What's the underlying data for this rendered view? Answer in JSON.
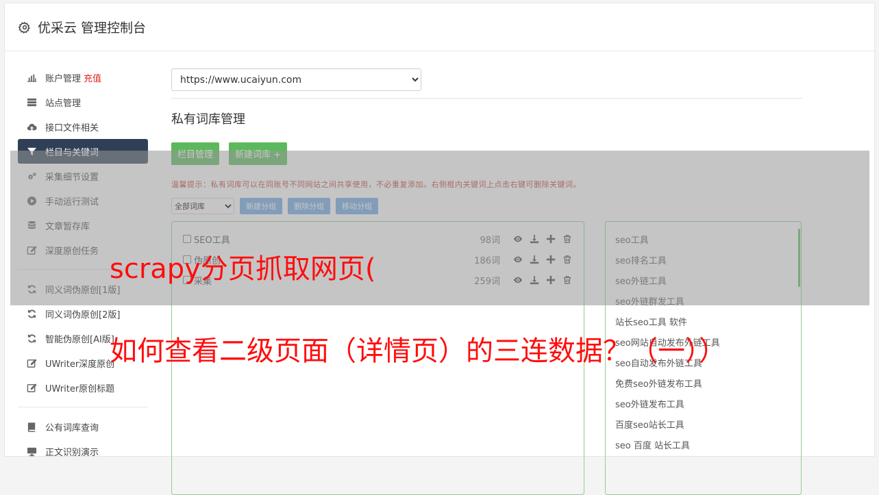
{
  "header": {
    "title": "优采云 管理控制台",
    "icon": "gear-icon"
  },
  "sidebar": {
    "items": [
      {
        "label": "账户管理",
        "extra": "充值",
        "icon": "bar-chart-icon"
      },
      {
        "label": "站点管理",
        "icon": "server-icon"
      },
      {
        "label": "接口文件相关",
        "icon": "cloud-upload-icon"
      },
      {
        "label": "栏目与关键词",
        "icon": "filter-icon",
        "active": true
      },
      {
        "label": "采集细节设置",
        "icon": "cogs-icon"
      },
      {
        "label": "手动运行测试",
        "icon": "play-circle-icon"
      },
      {
        "label": "文章暂存库",
        "icon": "database-icon"
      },
      {
        "label": "深度原创任务",
        "icon": "edit-icon"
      }
    ],
    "items2": [
      {
        "label": "同义词伪原创[1版]",
        "icon": "refresh-icon"
      },
      {
        "label": "同义词伪原创[2版]",
        "icon": "refresh-icon"
      },
      {
        "label": "智能伪原创[AI版]",
        "icon": "refresh-icon"
      },
      {
        "label": "UWriter深度原创",
        "icon": "edit-icon"
      },
      {
        "label": "UWriter原创标题",
        "icon": "edit-icon"
      }
    ],
    "items3": [
      {
        "label": "公有词库查询",
        "icon": "book-icon"
      },
      {
        "label": "正文识别演示",
        "icon": "monitor-icon"
      }
    ]
  },
  "main": {
    "site_select": "https://www.ucaiyun.com",
    "section_title": "私有词库管理",
    "btn_column": "栏目管理",
    "btn_new_lib": "新建词库 +",
    "tip": "温馨提示：私有词库可以在同账号不同网站之间共享使用，不必重复添加。右侧框内关键词上点击右键可删除关键词。",
    "group_select": "全部词库",
    "btn_new_group": "新建分组",
    "btn_del_group": "删除分组",
    "btn_move_group": "移动分组",
    "libraries": [
      {
        "name": "SEO工具",
        "count": "98词"
      },
      {
        "name": "伪原创",
        "count": "186词"
      },
      {
        "name": "采集",
        "count": "259词"
      }
    ],
    "keywords": [
      "seo工具",
      "seo排名工具",
      "seo外链工具",
      "seo外链群发工具",
      "站长seo工具 软件",
      "seo网站自动发布外链工具",
      "seo自动发布外链工具",
      "免费seo外链发布工具",
      "seo外链发布工具",
      "百度seo站长工具",
      "seo 百度 站长工具"
    ]
  },
  "overlay": {
    "line1": "scrapy分页抓取网页(",
    "line2": "如何查看二级页面（详情页）的三连数据？（一））"
  }
}
